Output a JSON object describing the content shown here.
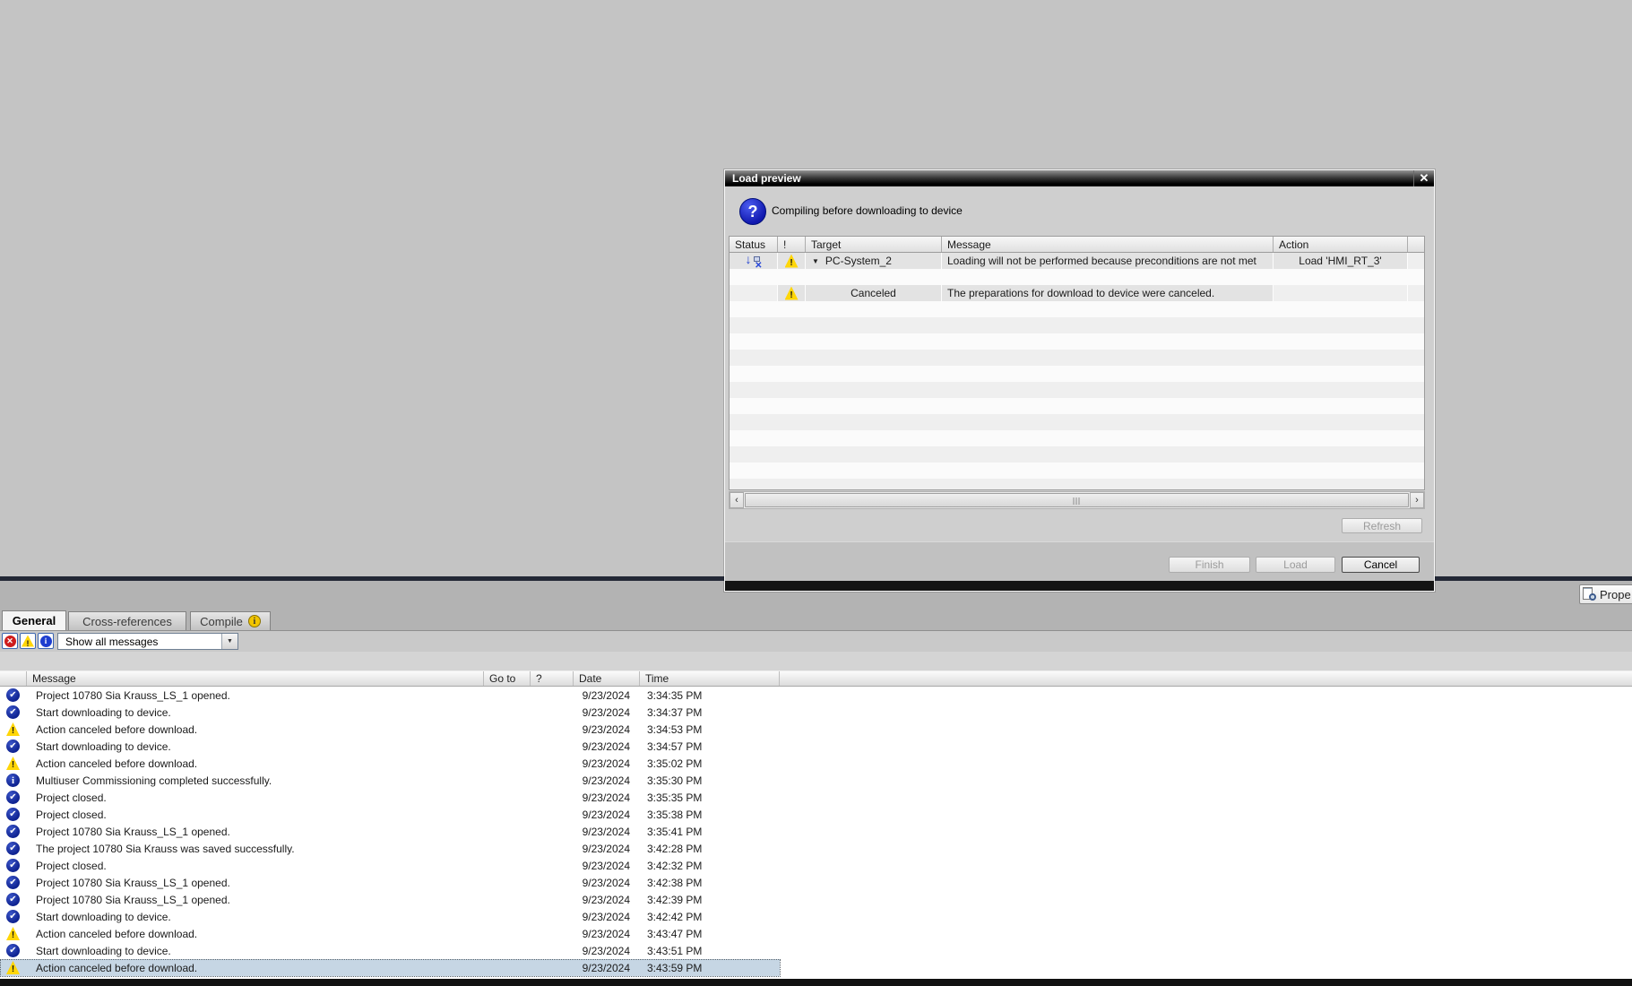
{
  "colors": {
    "canvas": "#c4c4c4",
    "selection": "#c6d6e4",
    "warning_yellow": "#ffd608",
    "success_blue": "#0e2290",
    "error_red": "#ce1c1c",
    "titlebar_black": "#000000"
  },
  "dialog": {
    "title": "Load preview",
    "info_text": "Compiling before downloading to device",
    "columns": {
      "status": "Status",
      "warn": "!",
      "target": "Target",
      "message": "Message",
      "action": "Action"
    },
    "row_preconditions": {
      "target": "PC-System_2",
      "message": "Loading will not be performed because preconditions are not met",
      "action": "Load 'HMI_RT_3'"
    },
    "row_canceled": {
      "target": "Canceled",
      "message": "The preparations for download to device were canceled."
    },
    "refresh_label": "Refresh",
    "finish_label": "Finish",
    "load_label": "Load",
    "cancel_label": "Cancel"
  },
  "inspector": {
    "properties_label": "Prope"
  },
  "tabs": {
    "general": "General",
    "cross_references": "Cross-references",
    "compile": "Compile"
  },
  "filter": {
    "value": "Show all messages"
  },
  "log": {
    "columns": {
      "message": "Message",
      "goto": "Go to",
      "help": "?",
      "date": "Date",
      "time": "Time"
    },
    "rows": [
      {
        "icon": "success",
        "message": "Project 10780 Sia Krauss_LS_1 opened.",
        "date": "9/23/2024",
        "time": "3:34:35 PM"
      },
      {
        "icon": "success",
        "message": "Start downloading to device.",
        "date": "9/23/2024",
        "time": "3:34:37 PM"
      },
      {
        "icon": "warning",
        "message": "Action canceled before download.",
        "date": "9/23/2024",
        "time": "3:34:53 PM"
      },
      {
        "icon": "success",
        "message": "Start downloading to device.",
        "date": "9/23/2024",
        "time": "3:34:57 PM"
      },
      {
        "icon": "warning",
        "message": "Action canceled before download.",
        "date": "9/23/2024",
        "time": "3:35:02 PM"
      },
      {
        "icon": "info",
        "message": "Multiuser Commissioning completed successfully.",
        "date": "9/23/2024",
        "time": "3:35:30 PM"
      },
      {
        "icon": "success",
        "message": "Project closed.",
        "date": "9/23/2024",
        "time": "3:35:35 PM"
      },
      {
        "icon": "success",
        "message": "Project closed.",
        "date": "9/23/2024",
        "time": "3:35:38 PM"
      },
      {
        "icon": "success",
        "message": "Project 10780 Sia Krauss_LS_1 opened.",
        "date": "9/23/2024",
        "time": "3:35:41 PM"
      },
      {
        "icon": "success",
        "message": "The project 10780 Sia Krauss was saved successfully.",
        "date": "9/23/2024",
        "time": "3:42:28 PM"
      },
      {
        "icon": "success",
        "message": "Project closed.",
        "date": "9/23/2024",
        "time": "3:42:32 PM"
      },
      {
        "icon": "success",
        "message": "Project 10780 Sia Krauss_LS_1 opened.",
        "date": "9/23/2024",
        "time": "3:42:38 PM"
      },
      {
        "icon": "success",
        "message": "Project 10780 Sia Krauss_LS_1 opened.",
        "date": "9/23/2024",
        "time": "3:42:39 PM"
      },
      {
        "icon": "success",
        "message": "Start downloading to device.",
        "date": "9/23/2024",
        "time": "3:42:42 PM"
      },
      {
        "icon": "warning",
        "message": "Action canceled before download.",
        "date": "9/23/2024",
        "time": "3:43:47 PM"
      },
      {
        "icon": "success",
        "message": "Start downloading to device.",
        "date": "9/23/2024",
        "time": "3:43:51 PM"
      },
      {
        "icon": "warning",
        "message": "Action canceled before download.",
        "date": "9/23/2024",
        "time": "3:43:59 PM",
        "selected": true
      }
    ]
  },
  "glyphs": {
    "close": "✕",
    "expander": "▼",
    "dropdown_arrow": "▼",
    "scroll_left": "‹",
    "scroll_right": "›"
  }
}
